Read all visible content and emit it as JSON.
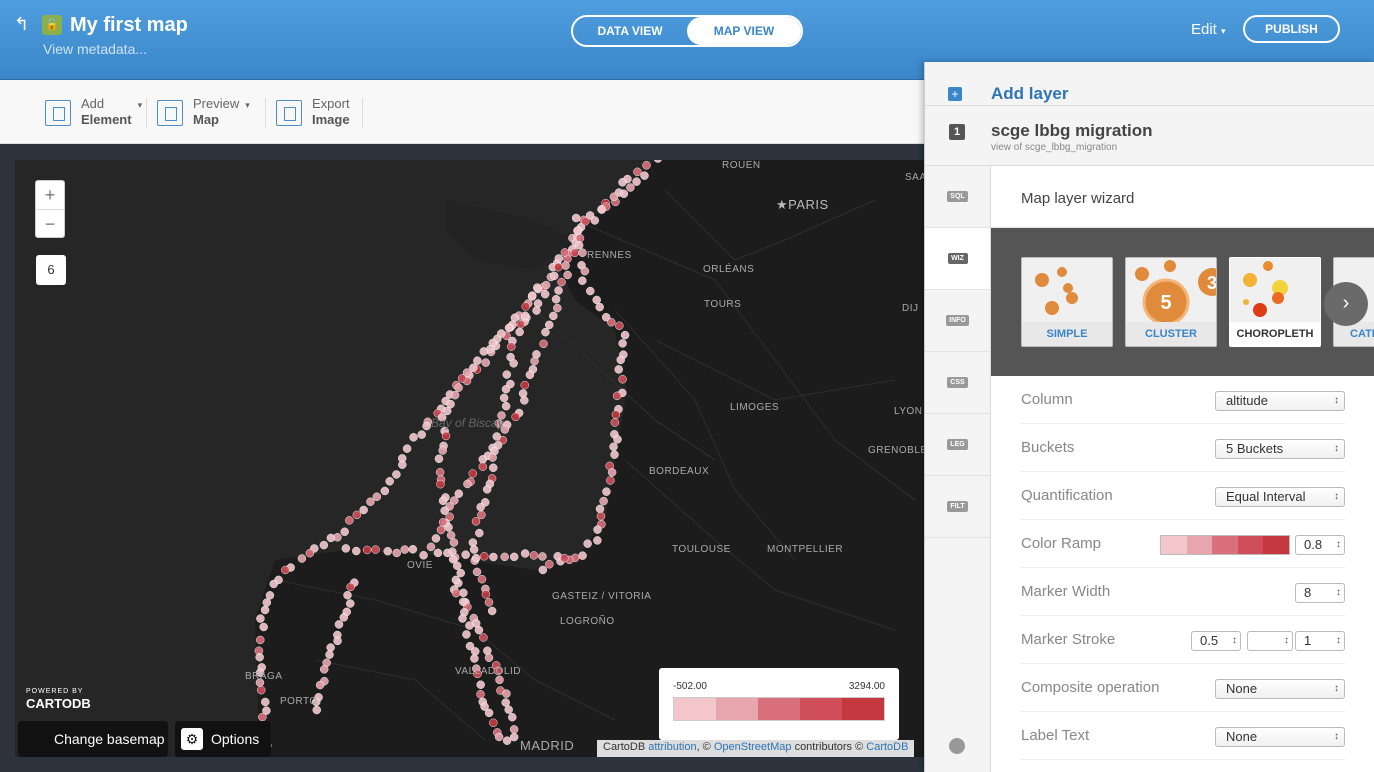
{
  "header": {
    "title": "My first map",
    "metadata_link": "View metadata...",
    "tabs": [
      "DATA VIEW",
      "MAP VIEW"
    ],
    "edit_label": "Edit",
    "publish_label": "PUBLISH"
  },
  "toolbar": {
    "add": {
      "line1": "Add",
      "line2": "Element"
    },
    "preview": {
      "line1": "Preview",
      "line2": "Map"
    },
    "export": {
      "line1": "Export",
      "line2": "Image"
    }
  },
  "map": {
    "zoom_in": "+",
    "zoom_out": "−",
    "zoom_level": "6",
    "cities": [
      "ROUEN",
      "PARIS",
      "RENNES",
      "ORLÉANS",
      "TOURS",
      "LIMOGES",
      "LYON",
      "DIJ",
      "GRENOBLE",
      "BORDEAUX",
      "TOULOUSE",
      "MONTPELLIER",
      "OVIE",
      "GASTEIZ / VITORIA",
      "LOGROÑO",
      "VALLADOLID",
      "BRAGA",
      "PORTO",
      "MADRID",
      "SAA"
    ],
    "bay_label": "Bay of Biscay",
    "powered_small": "POWERED BY",
    "powered_brand": "CARTODB",
    "basemap_label": "Change basemap",
    "options_label": "Options",
    "legend": {
      "min": "-502.00",
      "max": "3294.00",
      "colors": [
        "#f3c6cc",
        "#e7a5ae",
        "#d9707b",
        "#cf4e5a",
        "#c53840"
      ]
    },
    "attribution": {
      "prefix": "CartoDB",
      "link1": "attribution",
      "middle": ", ©",
      "link2": "OpenStreetMap",
      "middle2": "contributors ©",
      "link3": "CartoDB"
    }
  },
  "panel": {
    "add_layer": "Add layer",
    "layer_number": "1",
    "layer_name": "scge lbbg migration",
    "layer_sub": "view of scge_lbbg_migration",
    "side_tabs": [
      "SQL",
      "WIZ",
      "INFO",
      "CSS",
      "LEG",
      "FILT"
    ],
    "wizard_title": "Map layer wizard",
    "wizard_cards": [
      "SIMPLE",
      "CLUSTER",
      "CHOROPLETH",
      "CATE"
    ],
    "cluster_numbers": [
      "5",
      "3"
    ],
    "rows": [
      {
        "label": "Column",
        "value": "altitude"
      },
      {
        "label": "Buckets",
        "value": "5 Buckets"
      },
      {
        "label": "Quantification",
        "value": "Equal Interval"
      },
      {
        "label": "Color Ramp",
        "value": "0.8"
      },
      {
        "label": "Marker Width",
        "value": "8"
      },
      {
        "label": "Marker Stroke",
        "value": "0.5",
        "value2": "1"
      },
      {
        "label": "Composite operation",
        "value": "None"
      },
      {
        "label": "Label Text",
        "value": "None"
      }
    ]
  }
}
